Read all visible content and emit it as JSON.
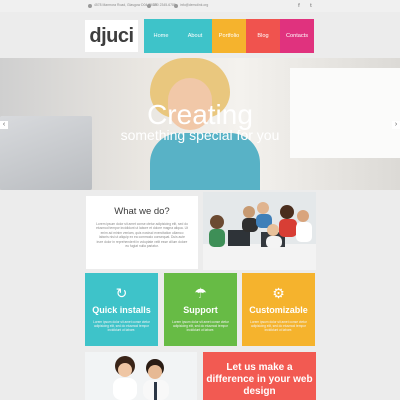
{
  "topbar": {
    "address": "4578 Marmora Road, Glasgow D04 89GR",
    "phone": "800 2345-6789",
    "email": "info@demolink.org",
    "social": [
      "f",
      "t"
    ]
  },
  "logo": "djuci",
  "nav": [
    {
      "label": "Home",
      "color": "#3ec3c9"
    },
    {
      "label": "About",
      "color": "#3ec3c9"
    },
    {
      "label": "Portfolio",
      "color": "#f5b32d"
    },
    {
      "label": "Blog",
      "color": "#f0534e"
    },
    {
      "label": "Contacts",
      "color": "#e0327e"
    }
  ],
  "hero": {
    "title": "Creating",
    "subtitle": "something special for you",
    "prev_icon": "chevron-left-icon",
    "next_icon": "chevron-right-icon"
  },
  "what_we_do": {
    "title": "What we do?",
    "text": "Lorem ipsum dolor sit amet conse ctetur adipisicing elit, sed do eiusmod tempor incididunt ut labore et dolore magna aliqua. Ut enim ad minim veniam, quis nostrud exercitation ullamco laboris nisi ut aliquip ex ea commodo consequat. Duis aute irure dolor in reprehenderit in voluptate velit esse cillum dolore eu fugiat nulla pariatur."
  },
  "features": [
    {
      "title": "Quick installs",
      "icon": "refresh-icon",
      "color": "#3ec3c9",
      "text": "Lorem ipsum dolor sit amet conse ctetur adipisicing elit, sed do eiusmod tempor incididunt ut labore."
    },
    {
      "title": "Support",
      "icon": "umbrella-icon",
      "color": "#67bb45",
      "text": "Lorem ipsum dolor sit amet conse ctetur adipisicing elit, sed do eiusmod tempor incididunt ut labore."
    },
    {
      "title": "Customizable",
      "icon": "gears-icon",
      "color": "#f5b32d",
      "text": "Lorem ipsum dolor sit amet conse ctetur adipisicing elit, sed do eiusmod tempor incididunt ut labore."
    }
  ],
  "cta": {
    "text": "Let us make a difference in your web design"
  }
}
